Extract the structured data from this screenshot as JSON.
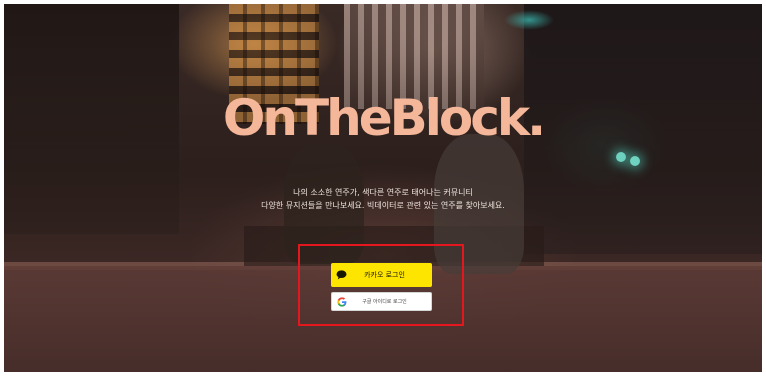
{
  "hero": {
    "logo": "OnTheBlock.",
    "tagline_line1": "나의 소소한 연주가, 색다른 연주로 태어나는 커뮤니티",
    "tagline_line2": "다양한 뮤지션들을 만나보세요. 빅데이터로 관련 있는 연주를 찾아보세요."
  },
  "login": {
    "kakao_label": "카카오 로그인",
    "google_label": "구글 아이디로 로그인",
    "kakao_icon": "speech-bubble-icon",
    "google_icon": "google-g-icon"
  },
  "colors": {
    "logo": "#f5b79a",
    "kakao_bg": "#fee500",
    "highlight_border": "#e4161e"
  }
}
